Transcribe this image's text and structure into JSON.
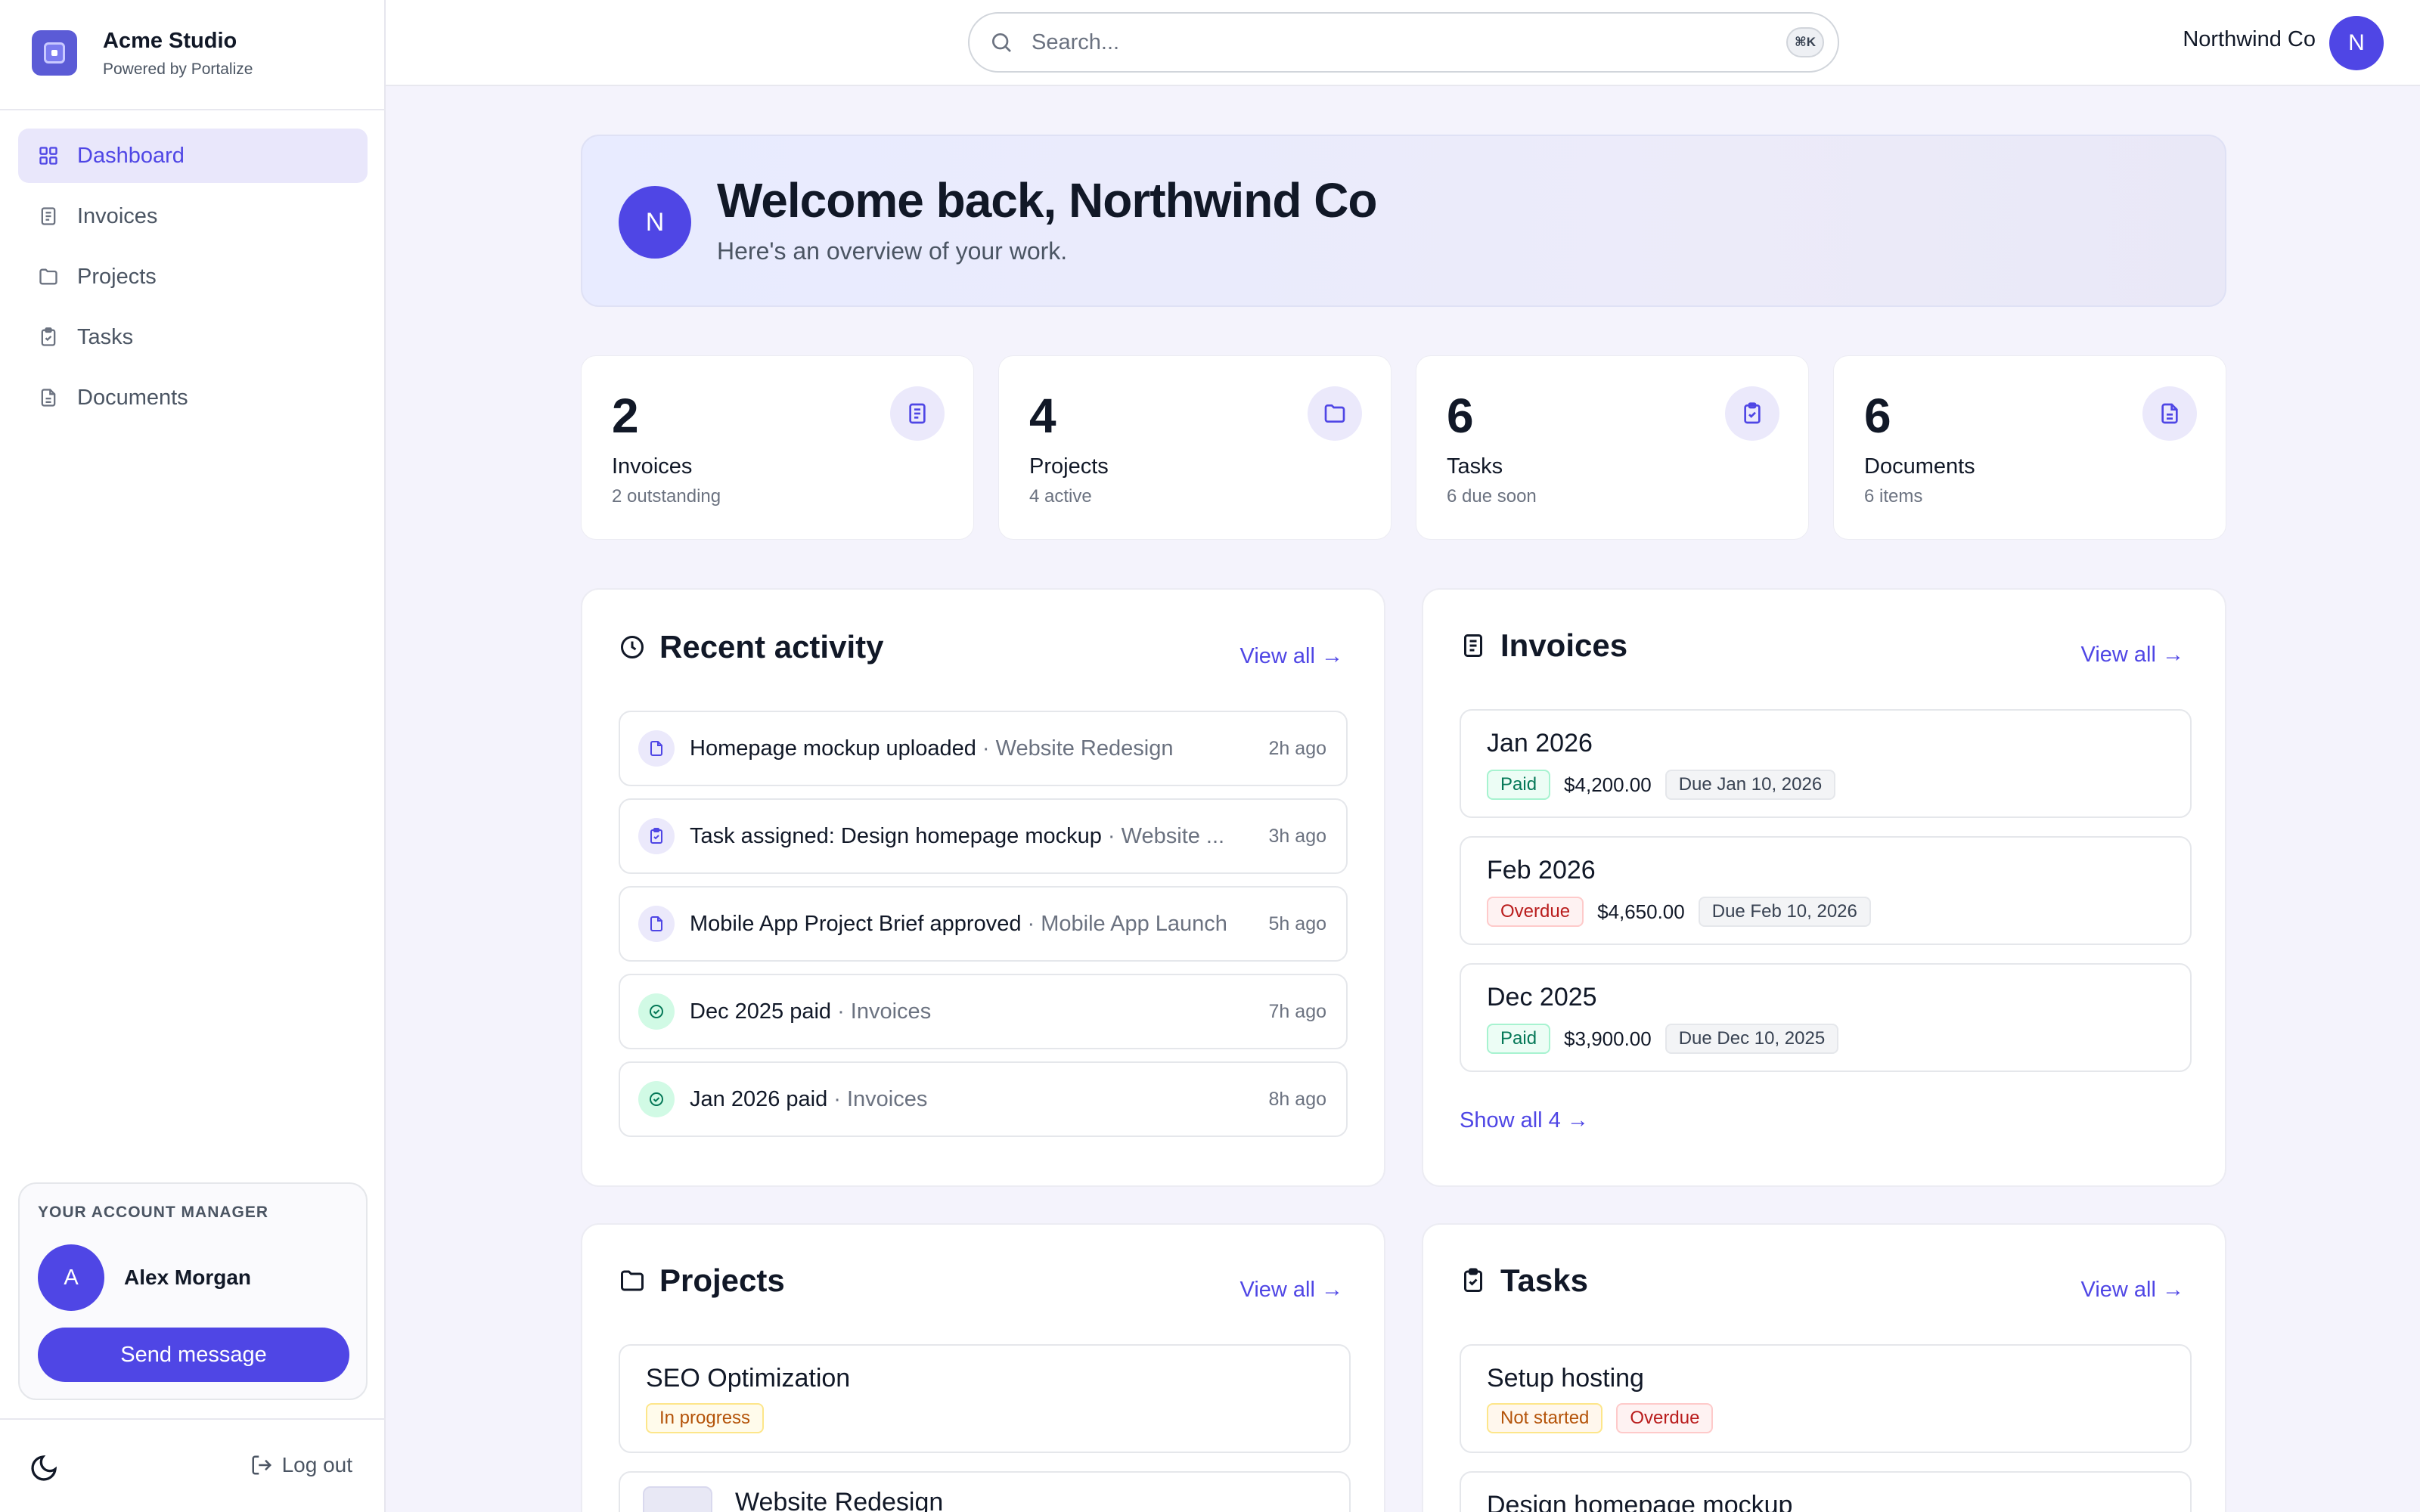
{
  "brand": {
    "name": "Acme Studio",
    "sub": "Powered by Portalize"
  },
  "nav": [
    {
      "label": "Dashboard",
      "icon": "dashboard-icon",
      "active": true
    },
    {
      "label": "Invoices",
      "icon": "invoice-icon"
    },
    {
      "label": "Projects",
      "icon": "folder-icon"
    },
    {
      "label": "Tasks",
      "icon": "clipboard-icon"
    },
    {
      "label": "Documents",
      "icon": "document-icon"
    }
  ],
  "manager": {
    "label": "YOUR ACCOUNT MANAGER",
    "initial": "A",
    "name": "Alex Morgan",
    "button": "Send message"
  },
  "footer": {
    "logout": "Log out"
  },
  "topbar": {
    "search_placeholder": "Search...",
    "shortcut": "⌘K",
    "user_name": "Northwind Co",
    "user_initial": "N"
  },
  "welcome": {
    "initial": "N",
    "title": "Welcome back, Northwind Co",
    "subtitle": "Here's an overview of your work."
  },
  "stats": [
    {
      "value": "2",
      "label": "Invoices",
      "sub": "2 outstanding"
    },
    {
      "value": "4",
      "label": "Projects",
      "sub": "4 active"
    },
    {
      "value": "6",
      "label": "Tasks",
      "sub": "6 due soon"
    },
    {
      "value": "6",
      "label": "Documents",
      "sub": "6 items"
    }
  ],
  "activity": {
    "title": "Recent activity",
    "view_all": "View all →",
    "items": [
      {
        "text": "Homepage mockup uploaded",
        "ctx": " · Website Redesign",
        "time": "2h ago"
      },
      {
        "text": "Task assigned: Design homepage mockup",
        "ctx": " · Website ...",
        "time": "3h ago"
      },
      {
        "text": "Mobile App Project Brief approved",
        "ctx": " · Mobile App Launch",
        "time": "5h ago"
      },
      {
        "text": "Dec 2025 paid",
        "ctx": " · Invoices",
        "time": "7h ago"
      },
      {
        "text": "Jan 2026 paid",
        "ctx": " · Invoices",
        "time": "8h ago"
      }
    ]
  },
  "invoices": {
    "title": "Invoices",
    "view_all": "View all →",
    "show_all": "Show all 4 →",
    "items": [
      {
        "title": "Jan 2026",
        "status": "Paid",
        "amount": "$4,200.00",
        "due": "Due Jan 10, 2026"
      },
      {
        "title": "Feb 2026",
        "status": "Overdue",
        "amount": "$4,650.00",
        "due": "Due Feb 10, 2026"
      },
      {
        "title": "Dec 2025",
        "status": "Paid",
        "amount": "$3,900.00",
        "due": "Due Dec 10, 2025"
      }
    ]
  },
  "projects": {
    "title": "Projects",
    "view_all": "View all →",
    "items": [
      {
        "title": "SEO Optimization",
        "badge": "In progress"
      },
      {
        "title": "Website Redesign"
      }
    ]
  },
  "tasks": {
    "title": "Tasks",
    "view_all": "View all →",
    "items": [
      {
        "title": "Setup hosting",
        "badge1": "Not started",
        "badge2": "Overdue"
      },
      {
        "title": "Design homepage mockup"
      }
    ]
  },
  "colors": {
    "accent": "#4f46e5",
    "paid": "#047857",
    "overdue": "#b91c1c",
    "progress": "#b45309"
  }
}
